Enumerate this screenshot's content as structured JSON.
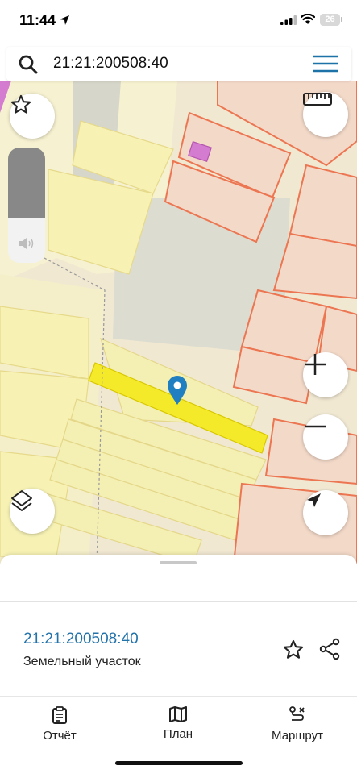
{
  "status": {
    "time": "11:44",
    "battery": "26"
  },
  "search": {
    "value": "21:21:200508:40"
  },
  "map_controls": {
    "favorite_icon": "star-outline-icon",
    "ruler_icon": "ruler-icon",
    "layers_icon": "layers-icon",
    "zoom_in_icon": "plus-icon",
    "zoom_out_icon": "minus-icon",
    "locate_icon": "navigation-arrow-icon",
    "pin_color": "#1f7fc1",
    "selected_parcel_color": "#f4ea2a"
  },
  "card": {
    "cadastral_number": "21:21:200508:40",
    "object_type": "Земельный участок"
  },
  "tabs": [
    {
      "label": "Отчёт",
      "icon": "report-icon"
    },
    {
      "label": "План",
      "icon": "map-icon"
    },
    {
      "label": "Маршрут",
      "icon": "route-icon"
    }
  ]
}
